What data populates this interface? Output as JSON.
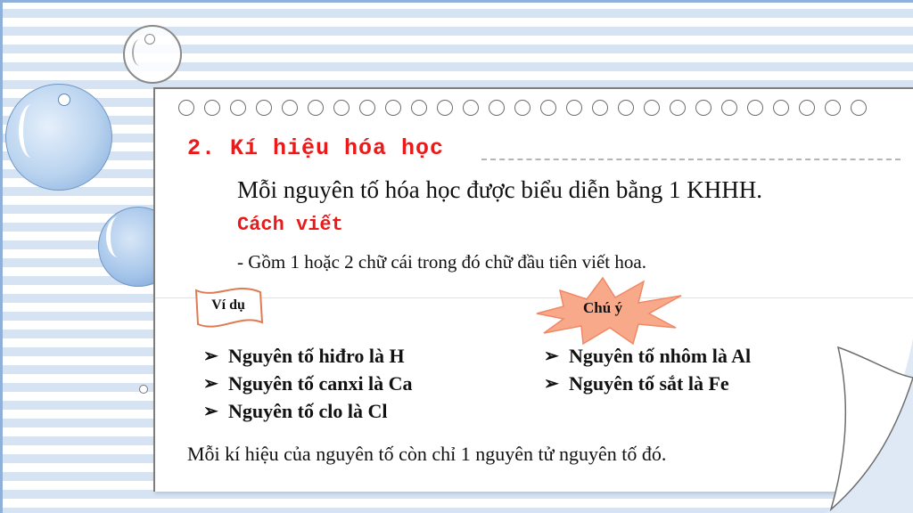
{
  "heading": "2. Kí hiệu hóa học",
  "statement": "Mỗi nguyên tố hóa học được biểu diễn bằng 1 KHHH.",
  "subheading": "Cách viết",
  "rule": "- Gồm 1 hoặc 2 chữ cái trong đó chữ đầu tiên viết hoa.",
  "example_tag": "Ví dụ",
  "note_tag": "Chú ý",
  "examples_left": [
    "Nguyên tố hiđro là H",
    "Nguyên tố canxi là Ca",
    "Nguyên tố clo là Cl"
  ],
  "examples_right": [
    "Nguyên tố nhôm là Al",
    "Nguyên tố sắt là Fe"
  ],
  "bullet_glyph": "➢",
  "conclusion": "Mỗi kí hiệu của nguyên tố còn chỉ 1 nguyên tử nguyên tố đó.",
  "colors": {
    "accent_red": "#e81a1a",
    "stripe_blue": "#d6e3f3",
    "note_burst": "#f7a98a",
    "tag_border": "#e07a50"
  }
}
